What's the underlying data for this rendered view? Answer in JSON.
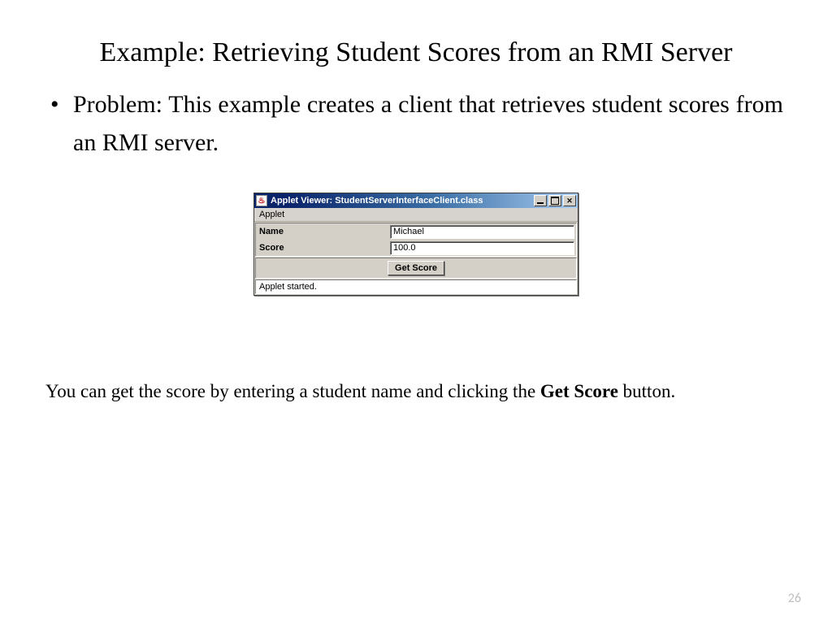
{
  "slide": {
    "title": "Example: Retrieving Student Scores from an RMI Server",
    "bullet": "Problem: This example creates a client that retrieves student scores from an RMI server.",
    "caption_1": "You can get the score by entering a student name and clicking the ",
    "caption_bold": "Get Score",
    "caption_2": " button.",
    "page_number": "26"
  },
  "applet": {
    "titlebar_text": "Applet Viewer: StudentServerInterfaceClient.class",
    "java_icon_glyph": "♨",
    "menu_item": "Applet",
    "label_name": "Name",
    "label_score": "Score",
    "value_name": "Michael",
    "value_score": "100.0",
    "button_label": "Get Score",
    "status_text": "Applet started.",
    "btn_close_glyph": "✕"
  }
}
